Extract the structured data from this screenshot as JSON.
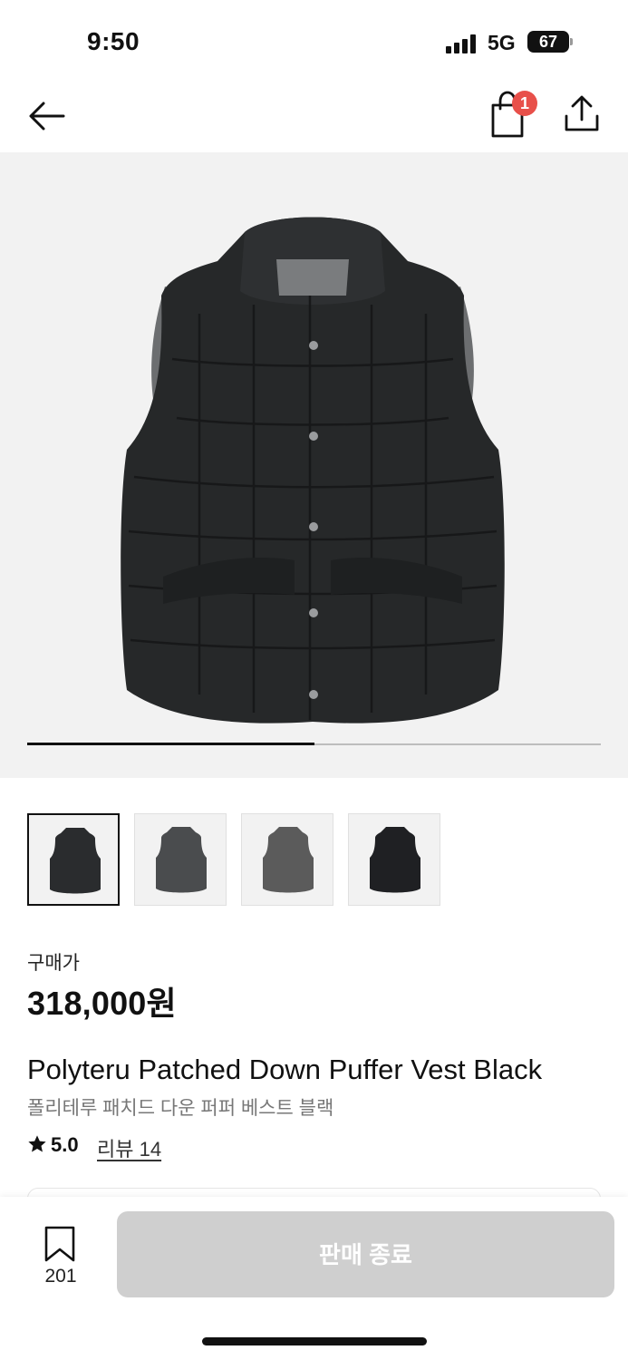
{
  "status_bar": {
    "time": "9:50",
    "network": "5G",
    "battery": "67"
  },
  "header": {
    "cart_badge": "1",
    "icons": [
      "arrow-left-icon",
      "shopping-bag-icon",
      "share-icon"
    ]
  },
  "gallery": {
    "progress": 0.5,
    "thumbnail_colors": [
      "#2a2c2e",
      "#4a4c4e",
      "#5b5b5b",
      "#1f2023"
    ]
  },
  "product": {
    "price_label": "구매가",
    "price": "318,000원",
    "name_en": "Polyteru Patched Down Puffer Vest Black",
    "name_ko": "폴리테루 패치드 다운 퍼퍼 베스트 블랙",
    "rating": "5.0",
    "review_link": "리뷰 14"
  },
  "bottom_bar": {
    "bookmark_count": "201",
    "cta_label": "판매 종료"
  },
  "colors": {
    "badge": "#e8504a",
    "cta_disabled": "#cfcfcf",
    "hero_bg": "#f2f2f2"
  }
}
